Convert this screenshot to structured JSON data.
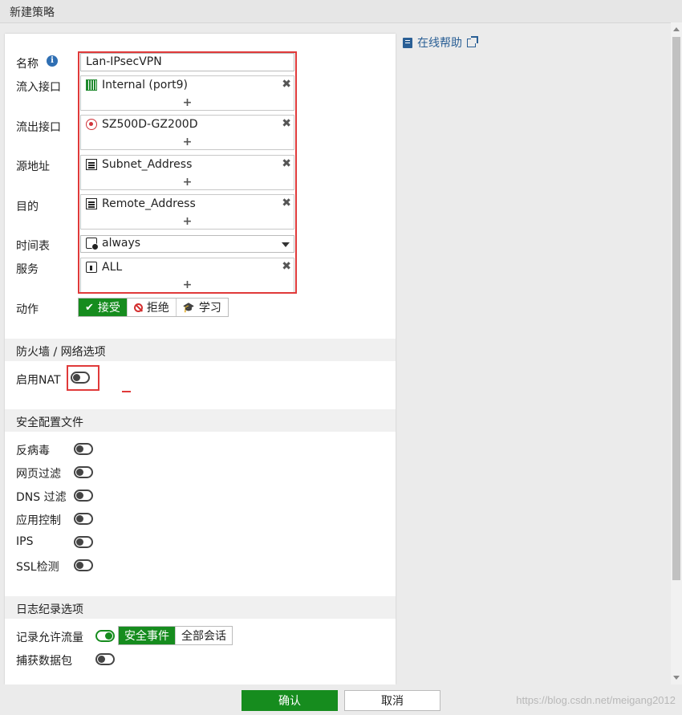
{
  "window": {
    "title": "新建策略"
  },
  "form": {
    "name_label": "名称",
    "name_value": "Lan-IPsecVPN",
    "incoming_label": "流入接口",
    "incoming_value": "Internal (port9)",
    "outgoing_label": "流出接口",
    "outgoing_value": "SZ500D-GZ200D",
    "source_label": "源地址",
    "source_value": "Subnet_Address",
    "destination_label": "目的",
    "destination_value": "Remote_Address",
    "schedule_label": "时间表",
    "schedule_value": "always",
    "service_label": "服务",
    "service_value": "ALL",
    "add_symbol": "+",
    "remove_symbol": "✖",
    "action_label": "动作",
    "actions": {
      "accept": "接受",
      "deny": "拒绝",
      "learn": "学习"
    },
    "action_selected": "accept"
  },
  "firewall_section": {
    "title": "防火墙 / 网络选项",
    "nat_label": "启用NAT",
    "nat_enabled": false
  },
  "security_section": {
    "title": "安全配置文件",
    "items": [
      {
        "label": "反病毒",
        "enabled": false
      },
      {
        "label": "网页过滤",
        "enabled": false
      },
      {
        "label": "DNS 过滤",
        "enabled": false
      },
      {
        "label": "应用控制",
        "enabled": false
      },
      {
        "label": "IPS",
        "enabled": false
      },
      {
        "label": "SSL检测",
        "enabled": false
      }
    ]
  },
  "logging_section": {
    "title": "日志纪录选项",
    "log_allowed_label": "记录允许流量",
    "log_allowed_enabled": true,
    "log_options": {
      "security_events": "安全事件",
      "all_sessions": "全部会话"
    },
    "log_selected": "security_events",
    "capture_label": "捕获数据包",
    "capture_enabled": false
  },
  "help": {
    "label": "在线帮助"
  },
  "footer": {
    "ok_label": "确认",
    "cancel_label": "取消",
    "watermark": "https://blog.csdn.net/meigang2012"
  },
  "colors": {
    "accent_green": "#168c1e",
    "highlight_red": "#e03a3a",
    "link_blue": "#2a5f95"
  }
}
